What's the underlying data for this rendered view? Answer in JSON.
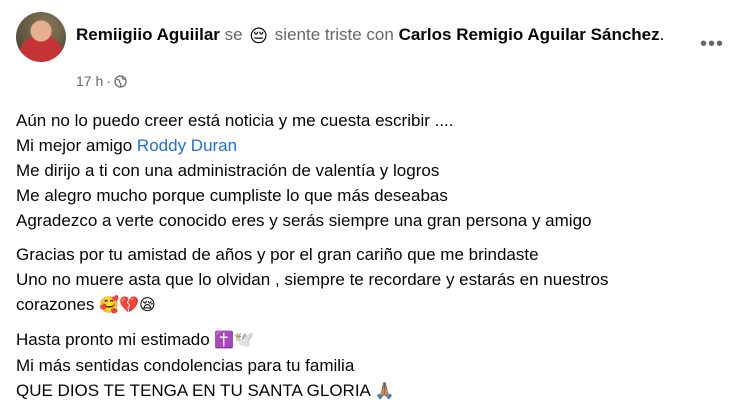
{
  "post": {
    "author": "Remiigiio Aguiilar",
    "se": " se ",
    "feeling_emoji": "😔",
    "feeling_text": " siente triste con ",
    "tagged": "Carlos Remigio Aguilar Sánchez",
    "tagged_suffix": ".",
    "time": "17 h",
    "separator": "·",
    "privacy_icon": "globe-icon",
    "more_icon": "more-options-icon",
    "more_label": "•••"
  },
  "content": {
    "p1": {
      "l1": "Aún no lo puedo creer está noticia y me cuesta escribir ....",
      "l2_prefix": "Mi mejor amigo ",
      "l2_mention": "Roddy Duran",
      "l3": "Me dirijo a ti con una administración de valentía y logros",
      "l4": "Me alegro mucho porque cumpliste lo que más deseabas",
      "l5": "Agradezco a verte conocido eres y serás siempre una gran persona y amigo"
    },
    "p2": {
      "l1": "Gracias por tu amistad de años y por el gran cariño que me brindaste",
      "l2": "Uno no muere asta que lo olvidan , siempre te recordare y estarás en nuestros",
      "l3": "corazones ",
      "l3_emojis": "🥰💔😪"
    },
    "p3": {
      "l1": "Hasta pronto mi estimado ",
      "l1_emojis": "✝️🕊️",
      "l2": "Mi más sentidas condolencias para tu familia",
      "l3": "QUE DIOS TE TENGA EN TU SANTA GLORIA ",
      "l3_emojis": "🙏🏽"
    }
  },
  "colors": {
    "link": "#216fdb",
    "muted": "#65676b",
    "text": "#050505"
  }
}
